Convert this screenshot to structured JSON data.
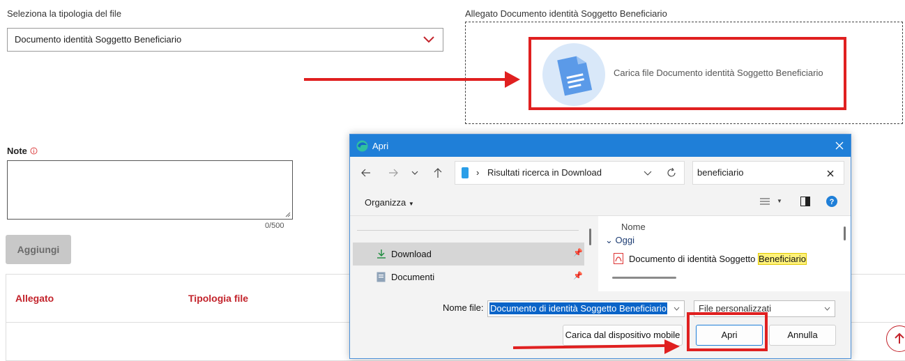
{
  "form": {
    "file_type_label": "Seleziona la tipologia del file",
    "file_type_value": "Documento identità Soggetto Beneficiario",
    "attachment_label": "Allegato Documento identità Soggetto Beneficiario",
    "upload_text": "Carica file Documento identità Soggetto Beneficiario",
    "note_label": "Note",
    "note_counter": "0/500",
    "add_button": "Aggiungi"
  },
  "table": {
    "columns": [
      "Allegato",
      "Tipologia file"
    ]
  },
  "dialog": {
    "title": "Apri",
    "path": "Risultati ricerca in Download",
    "search_value": "beneficiario",
    "organize": "Organizza",
    "sidebar": [
      {
        "label": "Download",
        "selected": true
      },
      {
        "label": "Documenti",
        "selected": false
      }
    ],
    "column_name": "Nome",
    "group": "Oggi",
    "file_prefix": "Documento di identità Soggetto ",
    "file_highlight": "Beneficiario",
    "filename_label": "Nome file:",
    "filename_value": "Documento di identità Soggetto Beneficiario",
    "filter_value": "File personalizzati",
    "mobile_button": "Carica dal dispositivo mobile",
    "open_button": "Apri",
    "cancel_button": "Annulla"
  },
  "colors": {
    "accent_red": "#c3232b",
    "annotation_red": "#e02020",
    "dialog_title_blue": "#1f7fd8",
    "selection_blue": "#0a64c8",
    "highlight_yellow": "#fff27a"
  },
  "icons": [
    "chevron-down-icon",
    "document-icon",
    "info-icon",
    "edge-icon",
    "close-icon",
    "back-icon",
    "forward-icon",
    "up-icon",
    "refresh-icon",
    "pdf-icon",
    "download-icon",
    "pin-icon",
    "help-icon",
    "arrow-up-icon"
  ]
}
